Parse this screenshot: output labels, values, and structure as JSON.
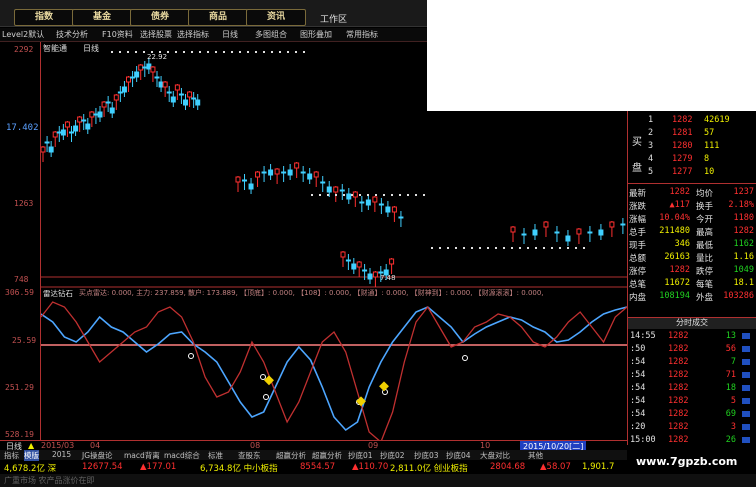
{
  "menu": {
    "items": [
      "指数",
      "基金",
      "债券",
      "商品",
      "资讯"
    ],
    "workarea": "工作区"
  },
  "toolbar": {
    "items": [
      "Level2默认",
      "技术分析",
      "F10资料",
      "选择股票",
      "选择指标",
      "日线",
      "多图组合",
      "图形叠加",
      "常用指标"
    ]
  },
  "chart_header": {
    "title": "智能通",
    "period": "日线"
  },
  "price_axis": {
    "labels": [
      "2292",
      "17.402",
      "1263",
      "748"
    ]
  },
  "indicator_axis": {
    "labels": [
      "306.59",
      "25.59",
      "251.29",
      "528.19"
    ]
  },
  "price_annotations": {
    "high": "22.92",
    "low": "7.48"
  },
  "indicator_header": {
    "name": "雷达钻石",
    "params": "买点雷达: 0.000, 主力: 237.859, 散户: 173.889, 【顶底】: 0.000, 【108】: 0.000, 【财通】: 0.000, 【财神到】: 0.000, 【财源滚滚】: 0.000,"
  },
  "orderbook": {
    "side_label": [
      "买",
      "盘"
    ],
    "rows": [
      {
        "level": "1",
        "price": "1282",
        "vol": "42619"
      },
      {
        "level": "2",
        "price": "1281",
        "vol": "57"
      },
      {
        "level": "3",
        "price": "1280",
        "vol": "111"
      },
      {
        "level": "4",
        "price": "1279",
        "vol": "8"
      },
      {
        "level": "5",
        "price": "1277",
        "vol": "10"
      }
    ]
  },
  "quote": {
    "rows": [
      {
        "l": "最新",
        "v": "1282",
        "l2": "均价",
        "v2": "1237"
      },
      {
        "l": "涨跌",
        "v": "▲117",
        "l2": "换手",
        "v2": "2.18%"
      },
      {
        "l": "涨幅",
        "v": "10.04%",
        "l2": "今开",
        "v2": "1180"
      },
      {
        "l": "总手",
        "v": "211480",
        "l2": "最高",
        "v2": "1282"
      },
      {
        "l": "现手",
        "v": "346",
        "l2": "最低",
        "v2": "1162"
      },
      {
        "l": "总额",
        "v": "26163",
        "l2": "量比",
        "v2": "1.16"
      },
      {
        "l": "涨停",
        "v": "1282",
        "l2": "跌停",
        "v2": "1049"
      },
      {
        "l": "总笔",
        "v": "11672",
        "l2": "每笔",
        "v2": "18.1"
      },
      {
        "l": "内盘",
        "v": "108194",
        "l2": "外盘",
        "v2": "103286"
      }
    ]
  },
  "ticks": {
    "header": "分时成交",
    "rows": [
      {
        "t": "14:55",
        "p": "1282",
        "v": "13"
      },
      {
        "t": ":50",
        "p": "1282",
        "v": "56"
      },
      {
        "t": ":54",
        "p": "1282",
        "v": "7"
      },
      {
        "t": ":54",
        "p": "1282",
        "v": "71"
      },
      {
        "t": ":54",
        "p": "1282",
        "v": "18"
      },
      {
        "t": ":54",
        "p": "1282",
        "v": "5"
      },
      {
        "t": ":54",
        "p": "1282",
        "v": "69"
      },
      {
        "t": ":20",
        "p": "1282",
        "v": "3"
      },
      {
        "t": "15:00",
        "p": "1282",
        "v": "26"
      }
    ]
  },
  "datebar": {
    "period": "日线",
    "y2015": "2015/03",
    "m04": "04",
    "m08": "08",
    "m09": "09",
    "m10": "10",
    "current": "2015/10/20[二]"
  },
  "tabs": [
    "指标",
    "模版",
    "2015",
    "JG操盘论",
    "macd背离",
    "macd综合",
    "标准",
    "查股东",
    "超赢分析",
    "超赢分析",
    "抄底01",
    "抄底02",
    "抄底03",
    "抄底04",
    "大盘对比",
    "其他"
  ],
  "ticker": {
    "a": "4,678.2亿 深",
    "b": "12677.54",
    "c": "▲177.01",
    "d": "6,734.8亿 中小板指",
    "e": "8554.57",
    "f": "▲110.70",
    "g": "2,811.0亿 创业板指",
    "h": "2804.68",
    "i": "▲58.07",
    "j": "1,901.7"
  },
  "status": "广重市场 农产品涨价在即",
  "watermark": "www.7gpzb.com"
}
